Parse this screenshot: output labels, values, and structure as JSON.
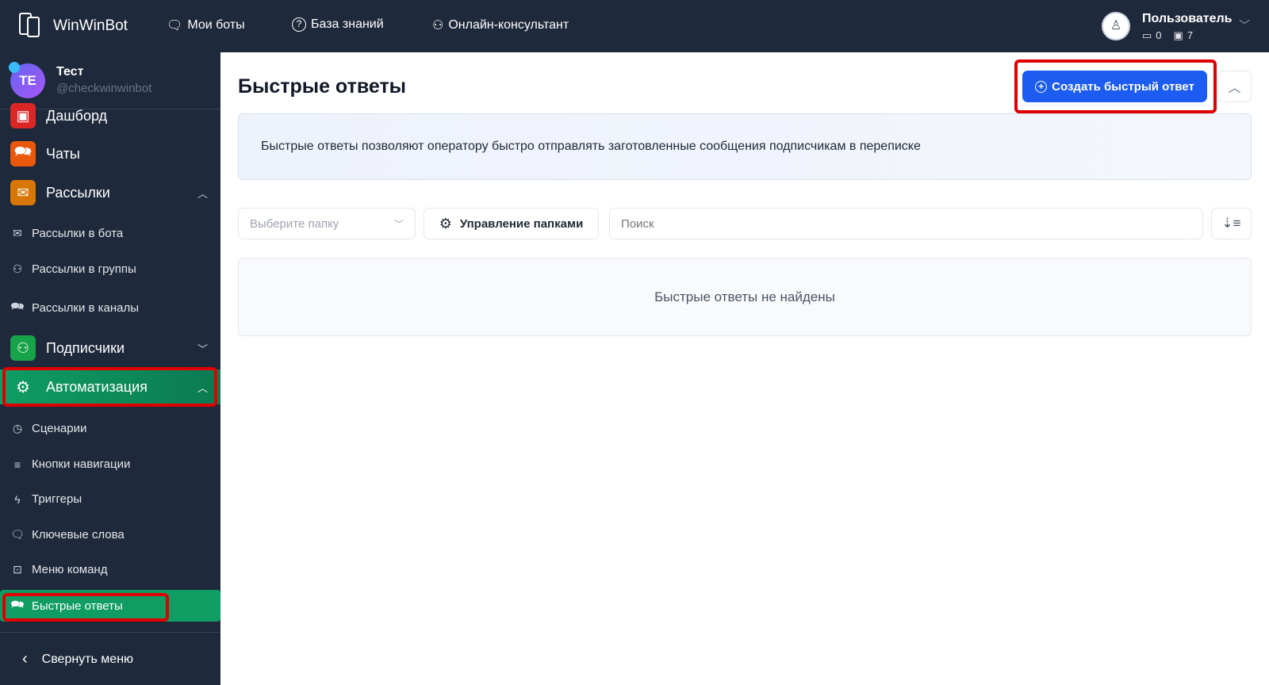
{
  "header": {
    "brand": "WinWinBot",
    "nav": [
      {
        "label": "Мои боты",
        "icon": "chat-bubble-icon"
      },
      {
        "label": "База знаний",
        "icon": "question-circle-icon"
      },
      {
        "label": "Онлайн-консультант",
        "icon": "users-icon"
      }
    ],
    "user": {
      "name": "Пользователь",
      "balance": "0",
      "days": "7"
    }
  },
  "sidebar": {
    "profile": {
      "initials": "TE",
      "name": "Тест",
      "handle": "@checkwinwinbot"
    },
    "items": [
      {
        "label": "Дашборд",
        "color": "#dc2626"
      },
      {
        "label": "Чаты",
        "color": "#ea580c"
      },
      {
        "label": "Рассылки",
        "color": "#d97706"
      }
    ],
    "mailing_sub": [
      "Рассылки в бота",
      "Рассылки в группы",
      "Рассылки в каналы"
    ],
    "subscribers": "Подписчики",
    "automation": "Автоматизация",
    "automation_sub": [
      "Сценарии",
      "Кнопки навигации",
      "Триггеры",
      "Ключевые слова",
      "Меню команд",
      "Быстрые ответы"
    ],
    "collapse": "Свернуть меню"
  },
  "main": {
    "title": "Быстрые ответы",
    "create_button": "Создать быстрый ответ",
    "info": "Быстрые ответы позволяют оператору быстро отправлять заготовленные сообщения подписчикам в переписке",
    "folder_placeholder": "Выберите папку",
    "manage_folders": "Управление папками",
    "search_placeholder": "Поиск",
    "empty": "Быстрые ответы не найдены"
  },
  "colors": {
    "accent": "#1d5cf0",
    "active": "#0f9d63",
    "header": "#1e293b"
  }
}
